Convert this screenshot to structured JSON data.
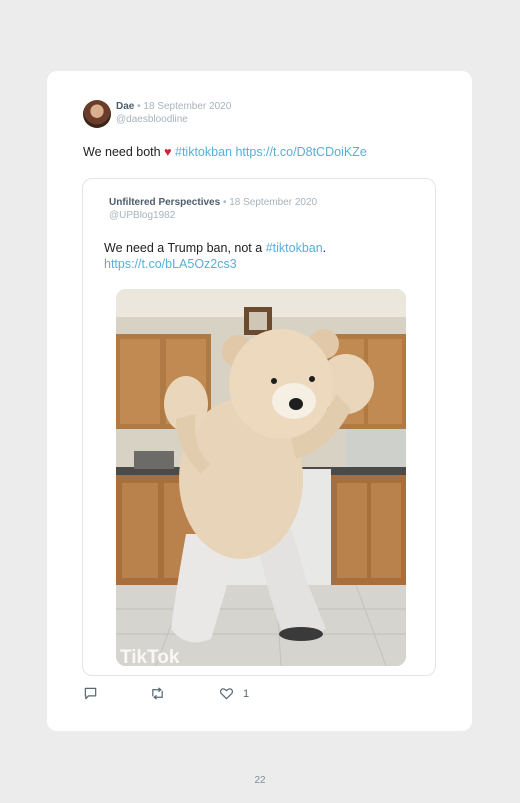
{
  "tweet": {
    "author": "Dae",
    "separator": " • ",
    "date": "18 September 2020",
    "handle": "@daesbloodline",
    "text_before": "We need both ",
    "hashtag": "#tiktokban",
    "url": "https://t.co/D8tCDoiKZe"
  },
  "quote": {
    "author": "Unfiltered Perspectives",
    "separator": " • ",
    "date": "18 September 2020",
    "handle": "@UPBlog1982",
    "text_before": "We need a Trump ban, not a ",
    "hashtag": "#tiktokban",
    "text_after": ".",
    "url": "https://t.co/bLA5Oz2cs3",
    "media_watermark": "TikTok"
  },
  "actions": {
    "reply_count": "",
    "retweet_count": "",
    "like_count": "1"
  },
  "footer": {
    "page_number": "22"
  },
  "icons": [
    "heart-emoji-icon",
    "reply-icon",
    "retweet-icon",
    "like-icon"
  ],
  "colors": {
    "link": "#5aaed7",
    "heart": "#d2202f",
    "author": "#4d5d6b",
    "muted": "#a8b3bc"
  }
}
